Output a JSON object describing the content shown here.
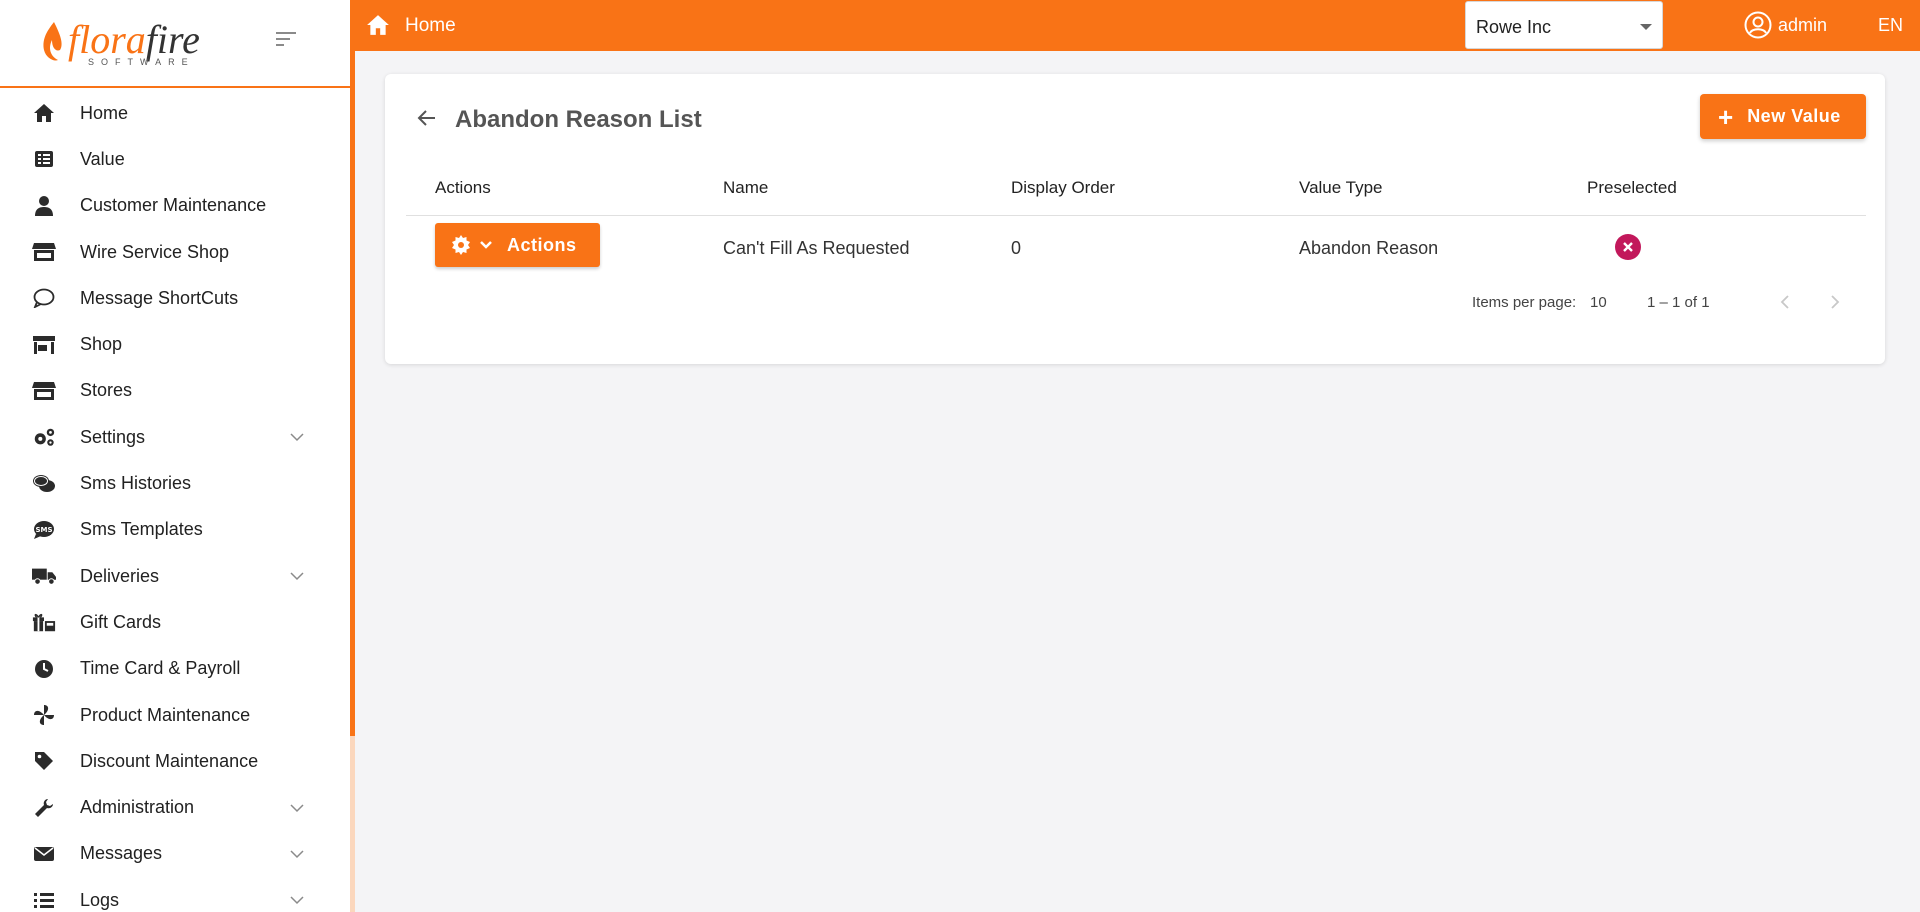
{
  "brand": {
    "name_part1": "flora",
    "name_part2": "fire",
    "subtitle": "SOFTWARE"
  },
  "sidebar": {
    "items": [
      {
        "label": "Home",
        "icon": "home-icon"
      },
      {
        "label": "Value",
        "icon": "list-icon"
      },
      {
        "label": "Customer Maintenance",
        "icon": "user-icon"
      },
      {
        "label": "Wire Service Shop",
        "icon": "store-icon"
      },
      {
        "label": "Message ShortCuts",
        "icon": "chat-bubble-icon"
      },
      {
        "label": "Shop",
        "icon": "shop-icon"
      },
      {
        "label": "Stores",
        "icon": "store-icon"
      },
      {
        "label": "Settings",
        "icon": "cogs-icon",
        "expandable": true
      },
      {
        "label": "Sms Histories",
        "icon": "comments-icon"
      },
      {
        "label": "Sms Templates",
        "icon": "sms-icon"
      },
      {
        "label": "Deliveries",
        "icon": "truck-icon",
        "expandable": true
      },
      {
        "label": "Gift Cards",
        "icon": "gift-icon"
      },
      {
        "label": "Time Card & Payroll",
        "icon": "clock-icon"
      },
      {
        "label": "Product Maintenance",
        "icon": "pinwheel-icon"
      },
      {
        "label": "Discount Maintenance",
        "icon": "tag-icon"
      },
      {
        "label": "Administration",
        "icon": "wrench-icon",
        "expandable": true
      },
      {
        "label": "Messages",
        "icon": "envelope-icon",
        "expandable": true
      },
      {
        "label": "Logs",
        "icon": "bullet-list-icon",
        "expandable": true
      }
    ]
  },
  "topbar": {
    "home_label": "Home",
    "company": "Rowe Inc",
    "user": "admin",
    "language": "EN"
  },
  "page": {
    "title": "Abandon Reason List",
    "new_button": "New Value",
    "columns": [
      "Actions",
      "Name",
      "Display Order",
      "Value Type",
      "Preselected"
    ],
    "rows": [
      {
        "actions_label": "Actions",
        "name": "Can't Fill As Requested",
        "display_order": "0",
        "value_type": "Abandon Reason",
        "preselected": false
      }
    ],
    "paginator": {
      "items_per_page_label": "Items per page:",
      "page_size": "10",
      "range": "1 – 1 of 1"
    }
  },
  "colors": {
    "accent": "#f97316",
    "preselected_no": "#c2185b"
  }
}
